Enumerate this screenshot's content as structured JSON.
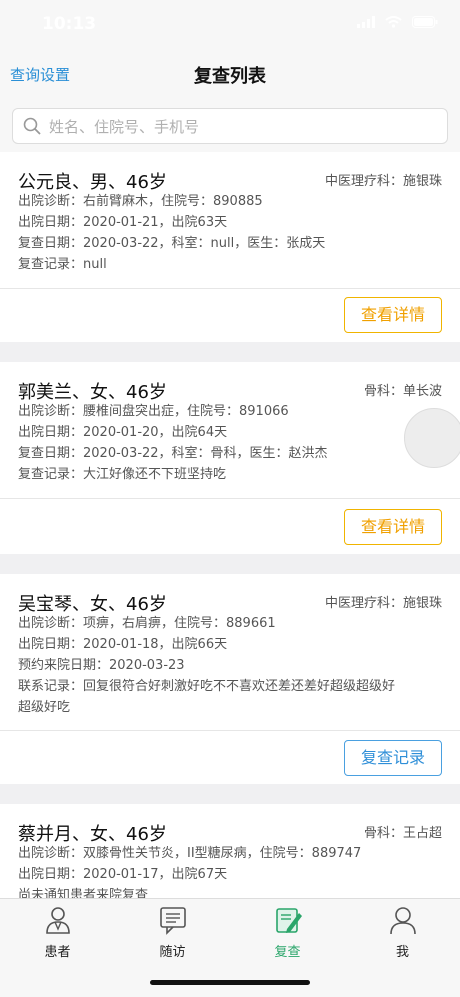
{
  "status": {
    "time": "10:13"
  },
  "nav": {
    "left_label": "查询设置",
    "title": "复查列表"
  },
  "search": {
    "placeholder": "姓名、住院号、手机号"
  },
  "cards": [
    {
      "name_line": "公元良、男、46岁",
      "dept": "中医理疗科：施银珠",
      "lines": [
        "出院诊断：右前臂麻木，住院号：890885",
        "出院日期：2020-01-21，出院63天",
        "复查日期：2020-03-22，科室：null，医生：张成天",
        "复查记录：null"
      ],
      "button": "查看详情"
    },
    {
      "name_line": "郭美兰、女、46岁",
      "dept": "骨科：单长波",
      "lines": [
        "出院诊断：腰椎间盘突出症，住院号：891066",
        "出院日期：2020-01-20，出院64天",
        "复查日期：2020-03-22，科室：骨科，医生：赵洪杰",
        "复查记录：大江好像还不下班坚持吃"
      ],
      "button": "查看详情"
    },
    {
      "name_line": "吴宝琴、女、46岁",
      "dept": "中医理疗科：施银珠",
      "lines": [
        "出院诊断：项痹，右肩痹，住院号：889661",
        "出院日期：2020-01-18，出院66天",
        "预约来院日期：2020-03-23",
        "联系记录：回复很符合好刺激好吃不不喜欢还差还差好超级超级好",
        "超级好吃"
      ],
      "button": "复查记录"
    },
    {
      "name_line": "蔡并月、女、46岁",
      "dept": "骨科：王占超",
      "lines": [
        "出院诊断：双膝骨性关节炎，II型糖尿病，住院号：889747",
        "出院日期：2020-01-17，出院67天",
        "尚未通知患者来院复查"
      ]
    }
  ],
  "tabs": [
    {
      "label": "患者",
      "icon": "patient-icon"
    },
    {
      "label": "随访",
      "icon": "followup-icon"
    },
    {
      "label": "复查",
      "icon": "recheck-icon"
    },
    {
      "label": "我",
      "icon": "me-icon"
    }
  ],
  "colors": {
    "accent_blue": "#2a8fd6",
    "button_yellow": "#f0b400",
    "tab_active": "#2aa56a"
  }
}
